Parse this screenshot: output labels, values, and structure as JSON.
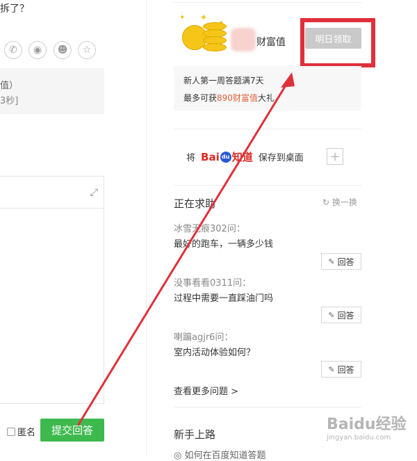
{
  "left": {
    "question_fragment": "拆了？",
    "info_line1": "值）",
    "info_line2": "3秒]",
    "share_icons": [
      "wechat-icon",
      "weibo-icon",
      "qq-icon",
      "favorite-icon"
    ],
    "anonymous_label": "匿名",
    "submit_label": "提交回答"
  },
  "wealth": {
    "label": "财富值",
    "claim_button": "明日领取"
  },
  "promo": {
    "line1": "新人第一周答题满7天",
    "line2_prefix": "最多可获",
    "line2_highlight": "890财富值",
    "line2_suffix": "大礼"
  },
  "save_desktop": {
    "prefix": "将",
    "logo_bai": "Bai",
    "logo_du": "du",
    "logo_zhidao": "知道",
    "suffix": "保存到桌面",
    "plus": "+"
  },
  "seeking": {
    "title": "正在求助",
    "refresh_label": "换一换",
    "items": [
      {
        "asker": "冰雪无痕302问：",
        "question": "最好的跑车，一辆多少钱",
        "answer_label": "回答"
      },
      {
        "asker": "没事看看0311问：",
        "question": "过程中需要一直踩油门吗",
        "answer_label": "回答"
      },
      {
        "asker": "喇蹁agjr6问：",
        "question": "室内活动体验如何？",
        "answer_label": "回答"
      }
    ],
    "more_label": "查看更多问题 >"
  },
  "guide": {
    "title": "新手上路",
    "first_item": "如何在百度知道答题"
  },
  "watermark": {
    "brand": "Baidu经验",
    "url": "jingyan.baidu.com"
  },
  "colors": {
    "submit_green": "#3eb94e",
    "annotation_red": "#e0303a",
    "highlight_orange": "#e0603a",
    "baidu_red": "#de2a22",
    "baidu_blue": "#2858d8"
  }
}
